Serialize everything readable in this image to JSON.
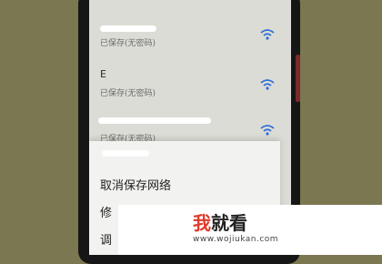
{
  "networks": [
    {
      "ssid": "",
      "status": "已保存(无密码)"
    },
    {
      "ssid": "E",
      "status": "已保存(无密码)"
    },
    {
      "ssid": "",
      "status": "已保存(无密码)"
    }
  ],
  "context_menu": {
    "title": "",
    "items": [
      "取消保存网络",
      "修",
      "调"
    ]
  },
  "watermark": {
    "brand_highlight": "我",
    "brand_rest": "就看",
    "url": "www.wojiukan.com"
  },
  "colors": {
    "wifi_icon": "#2f6fd6",
    "brand": "#e03a2a"
  }
}
